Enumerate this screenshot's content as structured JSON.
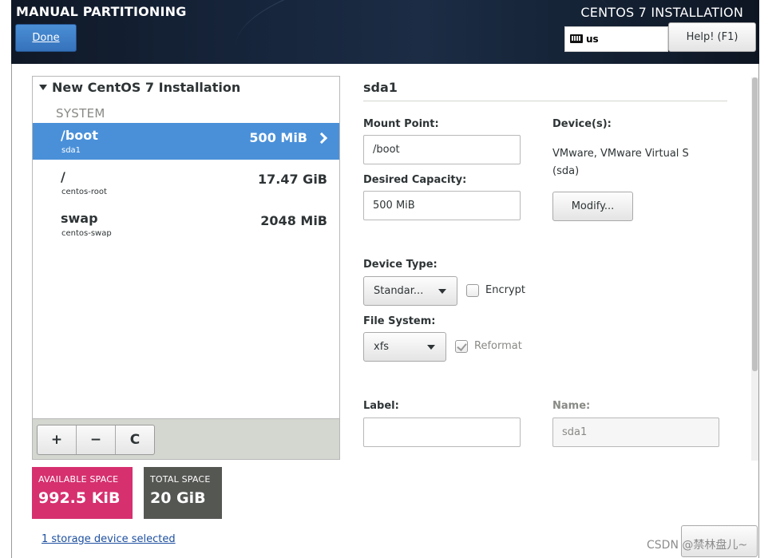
{
  "header": {
    "screen_title": "MANUAL PARTITIONING",
    "done_label": "Done",
    "installer_title": "CENTOS 7 INSTALLATION",
    "keyboard_layout": "us",
    "help_label": "Help! (F1)"
  },
  "partitions": {
    "tree_title": "New CentOS 7 Installation",
    "group_label": "SYSTEM",
    "rows": [
      {
        "mount_point": "/boot",
        "device": "sda1",
        "size": "500 MiB",
        "selected": true
      },
      {
        "mount_point": "/",
        "device": "centos-root",
        "size": "17.47 GiB",
        "selected": false
      },
      {
        "mount_point": "swap",
        "device": "centos-swap",
        "size": "2048 MiB",
        "selected": false
      }
    ],
    "toolbar": {
      "add": "+",
      "remove": "−",
      "refresh": "C"
    }
  },
  "space": {
    "available_label": "AVAILABLE SPACE",
    "available_value": "992.5 KiB",
    "total_label": "TOTAL SPACE",
    "total_value": "20 GiB",
    "colors": {
      "available": "#d6306f",
      "total": "#555753"
    }
  },
  "storage_link": "1 storage device selected",
  "details": {
    "title": "sda1",
    "mount_point_label": "Mount Point:",
    "mount_point_value": "/boot",
    "desired_capacity_label": "Desired Capacity:",
    "desired_capacity_value": "500 MiB",
    "devices_label": "Device(s):",
    "devices_value": "VMware, VMware Virtual S",
    "devices_value2": "(sda)",
    "modify_label": "Modify...",
    "device_type_label": "Device Type:",
    "device_type_value": "Standar...",
    "encrypt_label": "Encrypt",
    "encrypt_checked": false,
    "file_system_label": "File System:",
    "file_system_value": "xfs",
    "reformat_label": "Reformat",
    "reformat_checked": true,
    "label_label": "Label:",
    "label_value": "",
    "name_label": "Name:",
    "name_value": "sda1"
  },
  "watermark": "CSDN @禁林盘儿~",
  "accent_color": "#4a90d9"
}
